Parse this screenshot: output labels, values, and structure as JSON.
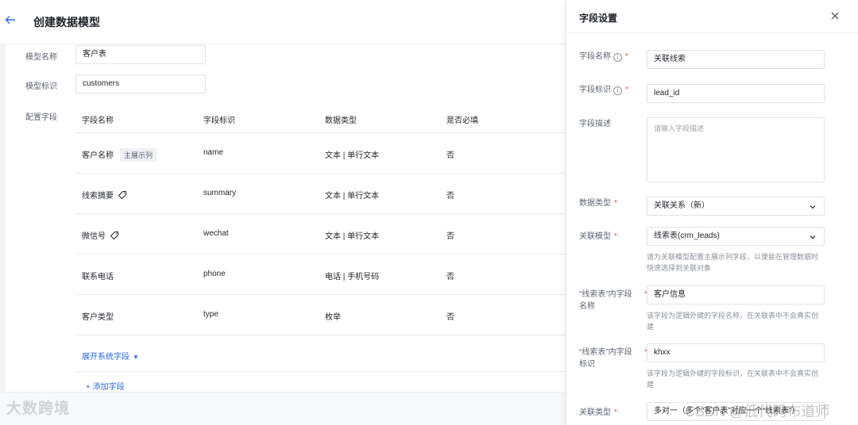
{
  "header": {
    "back_icon": "arrow-left-icon",
    "title": "创建数据模型"
  },
  "form": {
    "model_name_label": "模型名称",
    "model_name_value": "客户表",
    "model_id_label": "模型标识",
    "model_id_value": "customers",
    "fields_label": "配置字段"
  },
  "table": {
    "headers": [
      "字段名称",
      "字段标识",
      "数据类型",
      "是否必填"
    ],
    "rows": [
      {
        "name": "客户名称",
        "badge": "主展示列",
        "id": "name",
        "type": "文本 | 单行文本",
        "required": "否"
      },
      {
        "name": "线索摘要",
        "icon": "tag-icon",
        "id": "summary",
        "type": "文本 | 单行文本",
        "required": "否"
      },
      {
        "name": "微信号",
        "icon": "tag-icon",
        "id": "wechat",
        "type": "文本 | 单行文本",
        "required": "否"
      },
      {
        "name": "联系电话",
        "id": "phone",
        "type": "电话 | 手机号码",
        "required": "否"
      },
      {
        "name": "客户类型",
        "id": "type",
        "type": "枚举",
        "required": "否"
      }
    ],
    "expand_link": "展开系统字段",
    "add_field": "+ 添加字段"
  },
  "drawer": {
    "title": "字段设置",
    "close_icon": "close-icon",
    "field_name_label": "字段名称",
    "field_name_value": "关联线索",
    "field_id_label": "字段标识",
    "field_id_value": "lead_id",
    "field_desc_label": "字段描述",
    "field_desc_placeholder": "请输入字段描述",
    "data_type_label": "数据类型",
    "data_type_value": "关联关系（新）",
    "related_model_label": "关联模型",
    "related_model_value": "线索表(crm_leads)",
    "related_model_help": "请为关联模型配置主展示列字段，以便能在管理数据时快速选择到关联对象",
    "inner_name_label": "“线索表”内字段名称",
    "inner_name_value": "客户信息",
    "inner_name_help": "该字段为逻辑外键的字段名称，在关联表中不会真实创建",
    "inner_id_label": "“线索表”内字段标识",
    "inner_id_value": "khxx",
    "inner_id_help": "该字段为逻辑外键的字段标识，在关联表中不会真实创建",
    "relation_type_label": "关联类型",
    "relation_type_value": "多对一（多个“客户表”对应一个“线索表”）",
    "required_mark": "*",
    "info_icon": "i"
  },
  "watermarks": {
    "left": "大数跨境",
    "right": "CSDN @低代码布道师"
  },
  "colors": {
    "accent": "#2468f2",
    "required": "#f54a45"
  }
}
